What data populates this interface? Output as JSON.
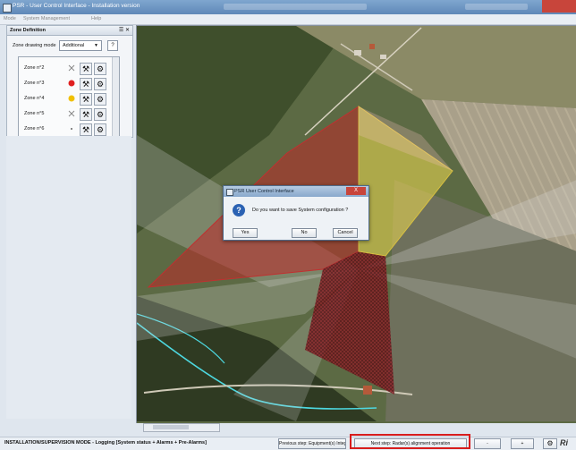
{
  "window": {
    "title": "PSR - User Control Interface - Installation version"
  },
  "menu": {
    "items": [
      "Mode",
      "System Management",
      "Help"
    ]
  },
  "zone_panel": {
    "title": "Zone Definition",
    "controls": "☰ ✕",
    "mode_label": "Zone drawing mode",
    "mode_value": "Additional",
    "help_label": "?",
    "zones": [
      {
        "name": "Zone n°2",
        "status": "cross"
      },
      {
        "name": "Zone n°3",
        "status": "red"
      },
      {
        "name": "Zone n°4",
        "status": "yellow"
      },
      {
        "name": "Zone n°5",
        "status": "cross"
      },
      {
        "name": "Zone n°6",
        "status": "dot"
      }
    ],
    "colors": {
      "red": "#e02020",
      "yellow": "#f0c000"
    }
  },
  "dialog": {
    "title": "PSR User Control Interface",
    "close_label": "X",
    "message": "Do you want to save System configuration ?",
    "buttons": {
      "yes": "Yes",
      "no": "No",
      "cancel": "Cancel"
    }
  },
  "statusbar": {
    "mode_text": "INSTALLATION/SUPERVISION MODE - Logging [System status + Alarms + Pre-Alarms]",
    "prev_step": "Previous step: Equipment(s) Integration ...",
    "next_step": "Next step: Radar(s) alignment operation",
    "minus": "-",
    "plus": "+",
    "brand": "Ri"
  }
}
